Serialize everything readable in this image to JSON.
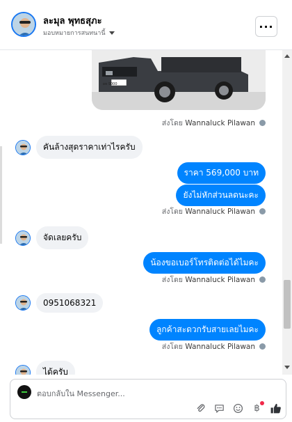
{
  "header": {
    "contact_name": "ละมุล พุทธสุภะ",
    "assign_label": "มอบหมายการสนทนานี้",
    "more_label": "···"
  },
  "messages": [
    {
      "type": "image",
      "sent_by": "ส่งโดย",
      "sender": "Wannaluck Pilawan",
      "plate": "ผห 9000"
    },
    {
      "type": "incoming",
      "text": "คันล้างสุดราคาเท่าไรครับ"
    },
    {
      "type": "outgoing",
      "text": "ราคา 569,000 บาท"
    },
    {
      "type": "outgoing",
      "text": "ยังไม่หักส่วนลดนะคะ",
      "sent_by": "ส่งโดย",
      "sender": "Wannaluck Pilawan"
    },
    {
      "type": "incoming",
      "text": "จัดเลยครับ"
    },
    {
      "type": "outgoing",
      "text": "น้องขอเบอร์โทรติดต่อได้ไมคะ",
      "sent_by": "ส่งโดย",
      "sender": "Wannaluck Pilawan"
    },
    {
      "type": "incoming",
      "text": "0951068321"
    },
    {
      "type": "outgoing",
      "text": "ลูกค้าสะดวกรับสายเลยไมคะ",
      "sent_by": "ส่งโดย",
      "sender": "Wannaluck Pilawan"
    },
    {
      "type": "incoming",
      "text": "ได้ครับ"
    }
  ],
  "composer": {
    "placeholder": "ตอบกลับใน Messenger...",
    "tools": [
      "attach-icon",
      "saved-reply-icon",
      "emoji-icon",
      "baht-icon",
      "like-icon"
    ],
    "baht_symbol": "฿"
  },
  "colors": {
    "accent": "#0084ff",
    "incoming_bubble": "#f0f2f5",
    "muted_text": "#65676b"
  }
}
